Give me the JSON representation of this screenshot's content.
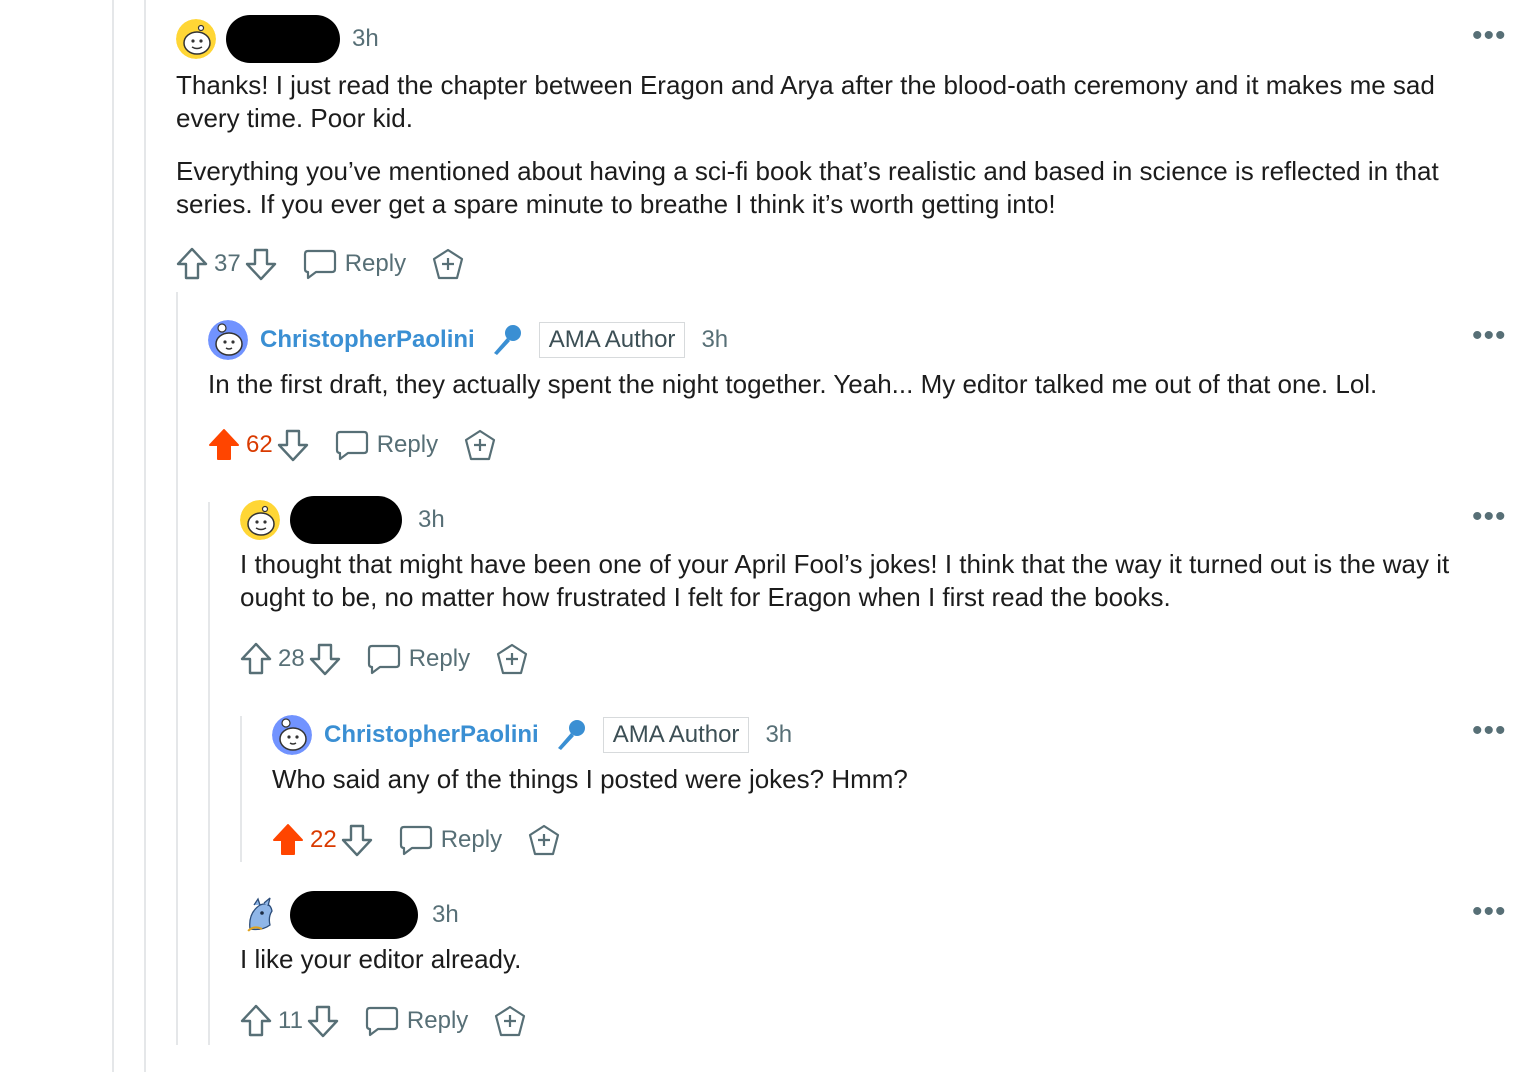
{
  "comments": [
    {
      "id": "c1",
      "time": "3h",
      "paragraphs": [
        "Thanks! I just read the chapter between Eragon and Arya after the blood-oath ceremony and it makes me sad every time. Poor kid.",
        "Everything you’ve mentioned about having a sci-fi book that’s realistic and based in science is reflected in that series. If you ever get a spare minute to breathe I think it’s worth getting into!"
      ],
      "score": "37",
      "upvoted": false,
      "reply_label": "Reply"
    },
    {
      "id": "c2",
      "username": "ChristopherPaolini",
      "flair": "AMA Author",
      "time": "3h",
      "paragraphs": [
        "In the first draft, they actually spent the night together. Yeah... My editor talked me out of that one. Lol."
      ],
      "score": "62",
      "upvoted": true,
      "reply_label": "Reply"
    },
    {
      "id": "c3",
      "time": "3h",
      "paragraphs": [
        "I thought that might have been one of your April Fool’s jokes! I think that the way it turned out is the way it ought to be, no matter how frustrated I felt for Eragon when I first read the books."
      ],
      "score": "28",
      "upvoted": false,
      "reply_label": "Reply"
    },
    {
      "id": "c4",
      "username": "ChristopherPaolini",
      "flair": "AMA Author",
      "time": "3h",
      "paragraphs": [
        "Who said any of the things I posted were jokes? Hmm?"
      ],
      "score": "22",
      "upvoted": true,
      "reply_label": "Reply"
    },
    {
      "id": "c5",
      "time": "3h",
      "paragraphs": [
        "I like your editor already."
      ],
      "score": "11",
      "upvoted": false,
      "reply_label": "Reply"
    }
  ],
  "icons": {
    "upvote": "upvote-arrow-icon",
    "downvote": "downvote-arrow-icon",
    "reply": "speech-bubble-icon",
    "award": "award-icon",
    "more": "more-options-icon",
    "mic": "microphone-icon"
  },
  "colors": {
    "upvote_active": "#ff4500",
    "score_active": "#d93a00",
    "username": "#3a8fd3",
    "muted": "#576f76"
  }
}
